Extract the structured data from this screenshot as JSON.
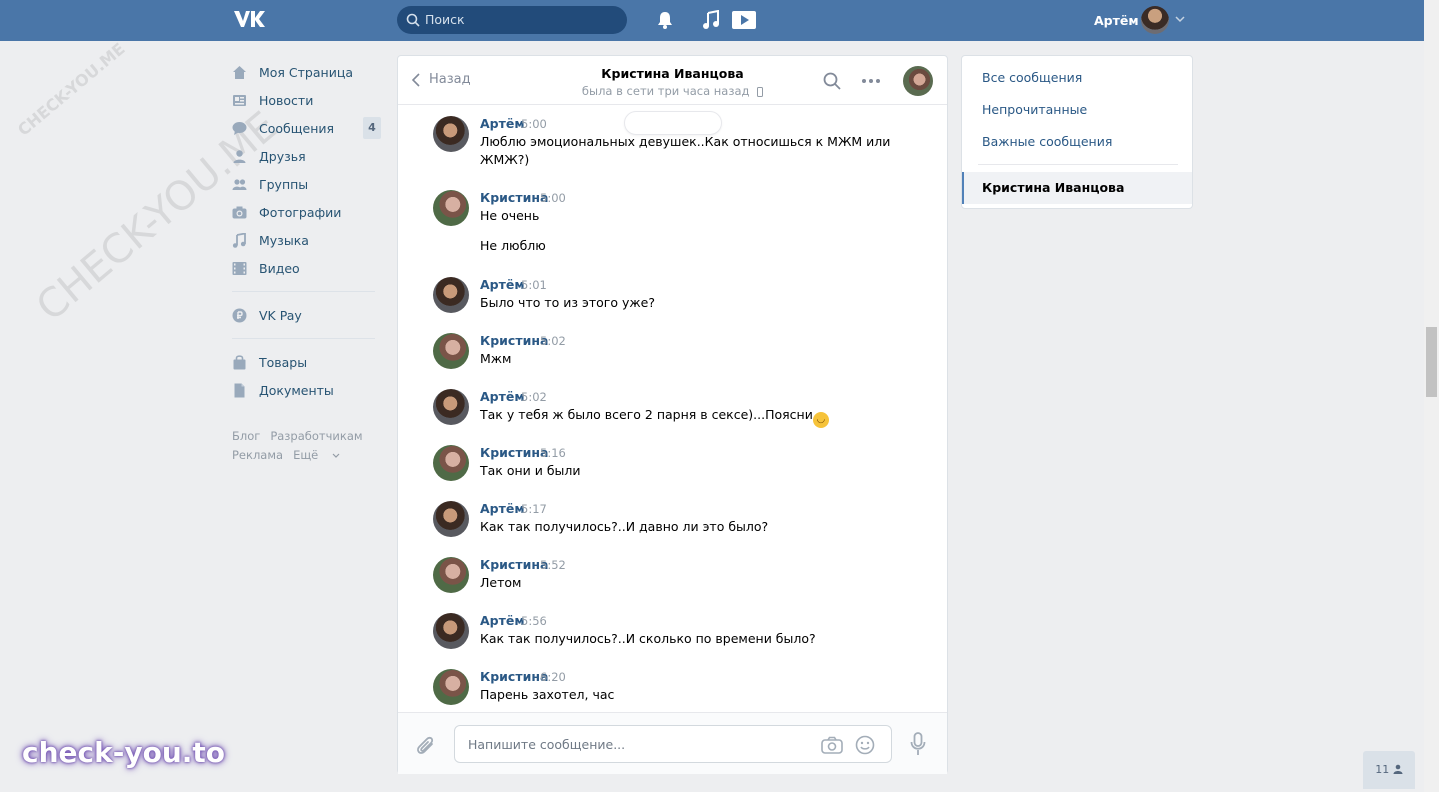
{
  "header": {
    "search_placeholder": "Поиск",
    "user_name": "Артём"
  },
  "left_nav": {
    "items": [
      {
        "label": "Моя Страница",
        "icon": "home-icon"
      },
      {
        "label": "Новости",
        "icon": "news-icon"
      },
      {
        "label": "Сообщения",
        "icon": "messages-icon",
        "badge": "4"
      },
      {
        "label": "Друзья",
        "icon": "friends-icon"
      },
      {
        "label": "Группы",
        "icon": "groups-icon"
      },
      {
        "label": "Фотографии",
        "icon": "camera-icon"
      },
      {
        "label": "Музыка",
        "icon": "music-icon"
      },
      {
        "label": "Видео",
        "icon": "video-icon"
      },
      {
        "label": "VK Pay",
        "icon": "vkpay-icon"
      },
      {
        "label": "Товары",
        "icon": "bag-icon"
      },
      {
        "label": "Документы",
        "icon": "document-icon"
      }
    ],
    "footer": [
      "Блог",
      "Разработчикам",
      "Реклама",
      "Ещё"
    ]
  },
  "chat": {
    "back_label": "Назад",
    "name": "Кристина Иванцова",
    "status": "была в сети три часа назад",
    "messages": [
      {
        "author": "Артём",
        "time": "5:00",
        "text": "Люблю эмоциональных девушек..Как относишься к МЖМ или ЖМЖ?)"
      },
      {
        "author": "Кристина",
        "time": "5:00",
        "text": "Не очень",
        "text2": "Не люблю"
      },
      {
        "author": "Артём",
        "time": "5:01",
        "text": "Было что то из этого уже?"
      },
      {
        "author": "Кристина",
        "time": "5:02",
        "text": "Мжм"
      },
      {
        "author": "Артём",
        "time": "5:02",
        "text": "Так у тебя ж было всего 2 парня в сексе)...Поясни"
      },
      {
        "author": "Кристина",
        "time": "5:16",
        "text": "Так они и были"
      },
      {
        "author": "Артём",
        "time": "5:17",
        "text": "Как так получилось?..И давно ли это было?"
      },
      {
        "author": "Кристина",
        "time": "5:52",
        "text": "Летом"
      },
      {
        "author": "Артём",
        "time": "5:56",
        "text": "Как так получилось?..И сколько по времени было?"
      },
      {
        "author": "Кристина",
        "time": "6:20",
        "text": "Парень захотел, час"
      }
    ],
    "composer_placeholder": "Напишите сообщение..."
  },
  "right_nav": {
    "items": [
      "Все сообщения",
      "Непрочитанные",
      "Важные сообщения"
    ],
    "active": "Кристина Иванцова"
  },
  "watermark": {
    "brand": "check-you.to",
    "diag": [
      "CHECK-YOU.ME",
      "CHECK-YOU.ME"
    ]
  },
  "online_count": "11",
  "colors": {
    "header": "#4a76a8",
    "link": "#2a5885",
    "background": "#edeef0"
  }
}
